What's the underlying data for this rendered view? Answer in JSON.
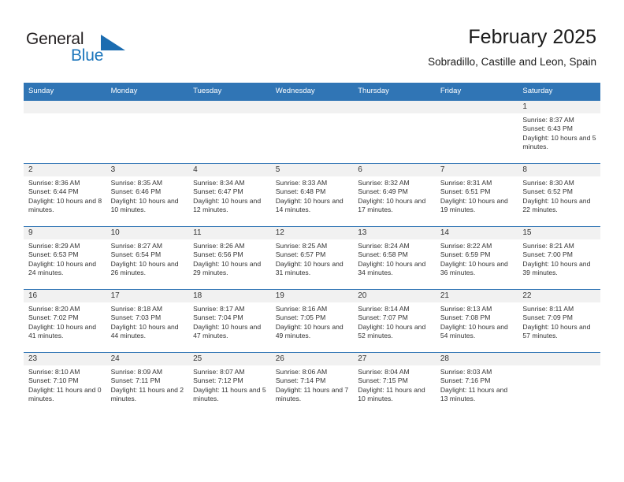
{
  "logo": {
    "word1": "General",
    "word2": "Blue",
    "triangle_color": "#1b6cb0",
    "blue_text_color": "#1b75bb"
  },
  "header": {
    "title": "February 2025",
    "subtitle": "Sobradillo, Castille and Leon, Spain"
  },
  "theme": {
    "header_blue": "#3075b5",
    "daybar_gray": "#f1f1f1",
    "text": "#333333"
  },
  "calendar": {
    "weekday_headers": [
      "Sunday",
      "Monday",
      "Tuesday",
      "Wednesday",
      "Thursday",
      "Friday",
      "Saturday"
    ],
    "labels": {
      "sunrise": "Sunrise:",
      "sunset": "Sunset:",
      "daylight": "Daylight:"
    },
    "weeks": [
      [
        {
          "day": "",
          "sunrise": "",
          "sunset": "",
          "daylight": ""
        },
        {
          "day": "",
          "sunrise": "",
          "sunset": "",
          "daylight": ""
        },
        {
          "day": "",
          "sunrise": "",
          "sunset": "",
          "daylight": ""
        },
        {
          "day": "",
          "sunrise": "",
          "sunset": "",
          "daylight": ""
        },
        {
          "day": "",
          "sunrise": "",
          "sunset": "",
          "daylight": ""
        },
        {
          "day": "",
          "sunrise": "",
          "sunset": "",
          "daylight": ""
        },
        {
          "day": "1",
          "sunrise": "Sunrise: 8:37 AM",
          "sunset": "Sunset: 6:43 PM",
          "daylight": "Daylight: 10 hours and 5 minutes."
        }
      ],
      [
        {
          "day": "2",
          "sunrise": "Sunrise: 8:36 AM",
          "sunset": "Sunset: 6:44 PM",
          "daylight": "Daylight: 10 hours and 8 minutes."
        },
        {
          "day": "3",
          "sunrise": "Sunrise: 8:35 AM",
          "sunset": "Sunset: 6:46 PM",
          "daylight": "Daylight: 10 hours and 10 minutes."
        },
        {
          "day": "4",
          "sunrise": "Sunrise: 8:34 AM",
          "sunset": "Sunset: 6:47 PM",
          "daylight": "Daylight: 10 hours and 12 minutes."
        },
        {
          "day": "5",
          "sunrise": "Sunrise: 8:33 AM",
          "sunset": "Sunset: 6:48 PM",
          "daylight": "Daylight: 10 hours and 14 minutes."
        },
        {
          "day": "6",
          "sunrise": "Sunrise: 8:32 AM",
          "sunset": "Sunset: 6:49 PM",
          "daylight": "Daylight: 10 hours and 17 minutes."
        },
        {
          "day": "7",
          "sunrise": "Sunrise: 8:31 AM",
          "sunset": "Sunset: 6:51 PM",
          "daylight": "Daylight: 10 hours and 19 minutes."
        },
        {
          "day": "8",
          "sunrise": "Sunrise: 8:30 AM",
          "sunset": "Sunset: 6:52 PM",
          "daylight": "Daylight: 10 hours and 22 minutes."
        }
      ],
      [
        {
          "day": "9",
          "sunrise": "Sunrise: 8:29 AM",
          "sunset": "Sunset: 6:53 PM",
          "daylight": "Daylight: 10 hours and 24 minutes."
        },
        {
          "day": "10",
          "sunrise": "Sunrise: 8:27 AM",
          "sunset": "Sunset: 6:54 PM",
          "daylight": "Daylight: 10 hours and 26 minutes."
        },
        {
          "day": "11",
          "sunrise": "Sunrise: 8:26 AM",
          "sunset": "Sunset: 6:56 PM",
          "daylight": "Daylight: 10 hours and 29 minutes."
        },
        {
          "day": "12",
          "sunrise": "Sunrise: 8:25 AM",
          "sunset": "Sunset: 6:57 PM",
          "daylight": "Daylight: 10 hours and 31 minutes."
        },
        {
          "day": "13",
          "sunrise": "Sunrise: 8:24 AM",
          "sunset": "Sunset: 6:58 PM",
          "daylight": "Daylight: 10 hours and 34 minutes."
        },
        {
          "day": "14",
          "sunrise": "Sunrise: 8:22 AM",
          "sunset": "Sunset: 6:59 PM",
          "daylight": "Daylight: 10 hours and 36 minutes."
        },
        {
          "day": "15",
          "sunrise": "Sunrise: 8:21 AM",
          "sunset": "Sunset: 7:00 PM",
          "daylight": "Daylight: 10 hours and 39 minutes."
        }
      ],
      [
        {
          "day": "16",
          "sunrise": "Sunrise: 8:20 AM",
          "sunset": "Sunset: 7:02 PM",
          "daylight": "Daylight: 10 hours and 41 minutes."
        },
        {
          "day": "17",
          "sunrise": "Sunrise: 8:18 AM",
          "sunset": "Sunset: 7:03 PM",
          "daylight": "Daylight: 10 hours and 44 minutes."
        },
        {
          "day": "18",
          "sunrise": "Sunrise: 8:17 AM",
          "sunset": "Sunset: 7:04 PM",
          "daylight": "Daylight: 10 hours and 47 minutes."
        },
        {
          "day": "19",
          "sunrise": "Sunrise: 8:16 AM",
          "sunset": "Sunset: 7:05 PM",
          "daylight": "Daylight: 10 hours and 49 minutes."
        },
        {
          "day": "20",
          "sunrise": "Sunrise: 8:14 AM",
          "sunset": "Sunset: 7:07 PM",
          "daylight": "Daylight: 10 hours and 52 minutes."
        },
        {
          "day": "21",
          "sunrise": "Sunrise: 8:13 AM",
          "sunset": "Sunset: 7:08 PM",
          "daylight": "Daylight: 10 hours and 54 minutes."
        },
        {
          "day": "22",
          "sunrise": "Sunrise: 8:11 AM",
          "sunset": "Sunset: 7:09 PM",
          "daylight": "Daylight: 10 hours and 57 minutes."
        }
      ],
      [
        {
          "day": "23",
          "sunrise": "Sunrise: 8:10 AM",
          "sunset": "Sunset: 7:10 PM",
          "daylight": "Daylight: 11 hours and 0 minutes."
        },
        {
          "day": "24",
          "sunrise": "Sunrise: 8:09 AM",
          "sunset": "Sunset: 7:11 PM",
          "daylight": "Daylight: 11 hours and 2 minutes."
        },
        {
          "day": "25",
          "sunrise": "Sunrise: 8:07 AM",
          "sunset": "Sunset: 7:12 PM",
          "daylight": "Daylight: 11 hours and 5 minutes."
        },
        {
          "day": "26",
          "sunrise": "Sunrise: 8:06 AM",
          "sunset": "Sunset: 7:14 PM",
          "daylight": "Daylight: 11 hours and 7 minutes."
        },
        {
          "day": "27",
          "sunrise": "Sunrise: 8:04 AM",
          "sunset": "Sunset: 7:15 PM",
          "daylight": "Daylight: 11 hours and 10 minutes."
        },
        {
          "day": "28",
          "sunrise": "Sunrise: 8:03 AM",
          "sunset": "Sunset: 7:16 PM",
          "daylight": "Daylight: 11 hours and 13 minutes."
        },
        {
          "day": "",
          "sunrise": "",
          "sunset": "",
          "daylight": ""
        }
      ]
    ]
  }
}
